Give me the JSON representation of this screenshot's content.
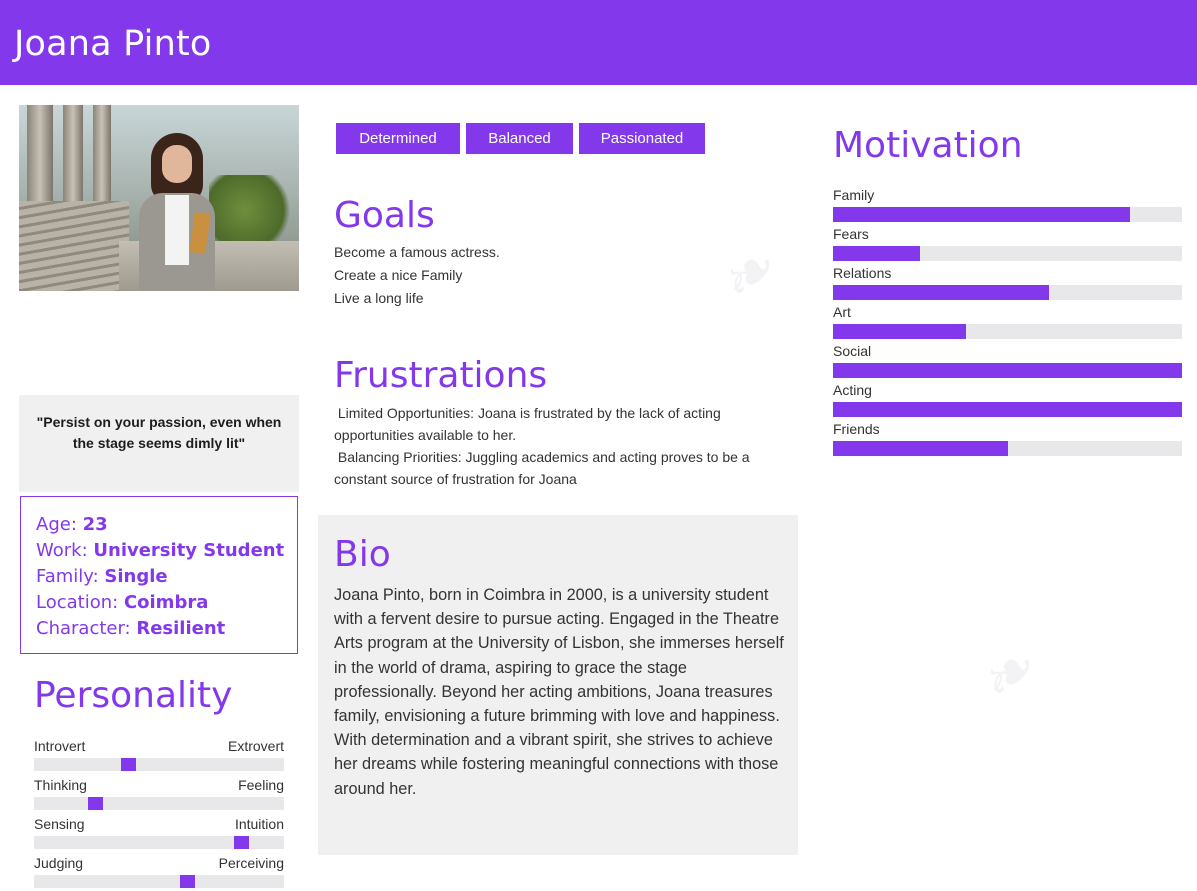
{
  "header": {
    "name": "Joana Pinto"
  },
  "photo": {
    "alt": "Portrait of Joana Pinto"
  },
  "quote": "\"Persist on your passion, even when the stage seems dimly lit\"",
  "info": [
    {
      "label": "Age:",
      "value": "23"
    },
    {
      "label": "Work:",
      "value": "University Student"
    },
    {
      "label": "Family:",
      "value": "Single"
    },
    {
      "label": "Location:",
      "value": "Coimbra"
    },
    {
      "label": "Character:",
      "value": "Resilient"
    }
  ],
  "personality": {
    "title": "Personality",
    "traits": [
      {
        "left": "Introvert",
        "right": "Extrovert",
        "value": 0.37
      },
      {
        "left": "Thinking",
        "right": "Feeling",
        "value": 0.23
      },
      {
        "left": "Sensing",
        "right": "Intuition",
        "value": 0.85
      },
      {
        "left": "Judging",
        "right": "Perceiving",
        "value": 0.62
      }
    ]
  },
  "tags": [
    "Determined",
    "Balanced",
    "Passionated"
  ],
  "goals": {
    "title": "Goals",
    "items": [
      "Become a famous actress.",
      "Create a nice Family",
      "Live a long life"
    ]
  },
  "frustrations": {
    "title": "Frustrations",
    "items": [
      " Limited Opportunities: Joana is frustrated by the lack of acting opportunities available to her.",
      " Balancing Priorities: Juggling academics and acting proves to be a constant source of frustration for Joana"
    ]
  },
  "bio": {
    "title": "Bio",
    "text": "Joana Pinto, born in Coimbra in 2000, is a university student with a fervent desire to pursue acting. Engaged in the Theatre Arts program at the University of Lisbon, she immerses herself in the world of drama, aspiring to grace the stage professionally. Beyond her acting ambitions, Joana treasures family, envisioning a future brimming with love and happiness. With determination and a vibrant spirit, she strives to achieve her dreams while fostering meaningful connections with those around her."
  },
  "motivation": {
    "title": "Motivation",
    "items": [
      {
        "label": "Family",
        "value": 0.85
      },
      {
        "label": "Fears",
        "value": 0.25
      },
      {
        "label": "Relations",
        "value": 0.62
      },
      {
        "label": "Art",
        "value": 0.38
      },
      {
        "label": "Social",
        "value": 1.0
      },
      {
        "label": "Acting",
        "value": 1.0
      },
      {
        "label": "Friends",
        "value": 0.5
      }
    ]
  },
  "colors": {
    "accent": "#8338ec",
    "panel": "#f0f0f0",
    "track": "#e8e7ea"
  }
}
